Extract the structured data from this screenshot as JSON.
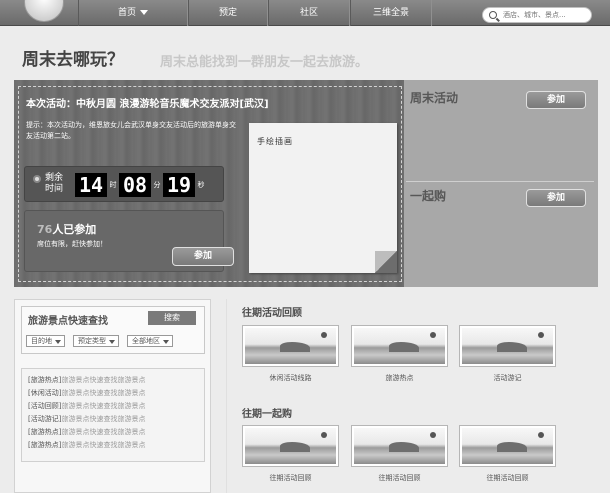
{
  "nav": {
    "items": [
      {
        "label": "首页",
        "dropdown": true
      },
      {
        "label": "预定",
        "dropdown": false
      },
      {
        "label": "社区",
        "dropdown": false
      },
      {
        "label": "三维全景",
        "dropdown": false
      }
    ],
    "search_placeholder": "酒店、城市、景点..."
  },
  "headline": {
    "title": "周末去哪玩？",
    "subtitle": "周末总能找到一群朋友一起去旅游。"
  },
  "event": {
    "title": "本次活动：中秋月圆 浪漫游轮音乐魔术交友派对[武汉]",
    "tip": "提示：本次活动为，维恩旅女儿会武汉单身交友活动后的旅游单身交友活动第二站。",
    "remain_label": "剩余时间",
    "hours": "14",
    "hours_unit": "时",
    "minutes": "08",
    "minutes_unit": "分",
    "seconds": "19",
    "seconds_unit": "秒",
    "join_num": "76",
    "join_suffix": "人已参加",
    "join_note": "席位有限，赶快参加！",
    "join_btn": "参加",
    "note_text": "手绘插画"
  },
  "side": {
    "weekend_title": "周末活动",
    "weekend_btn": "参加",
    "group_title": "一起购",
    "group_btn": "参加"
  },
  "quick_search": {
    "title": "旅游景点快速查找",
    "button": "搜索",
    "selects": [
      "目的地",
      "预定类型",
      "全部地区"
    ]
  },
  "list": [
    {
      "tag": "[旅游热点]",
      "text": "旅游景点快速查找旅游景点"
    },
    {
      "tag": "[休闲活动]",
      "text": "旅游景点快速查找旅游景点"
    },
    {
      "tag": "[活动回顾]",
      "text": "旅游景点快速查找旅游景点"
    },
    {
      "tag": "[活动游记]",
      "text": "旅游景点快速查找旅游景点"
    },
    {
      "tag": "[旅游热点]",
      "text": "旅游景点快速查找旅游景点"
    },
    {
      "tag": "[旅游热点]",
      "text": "旅游景点快速查找旅游景点"
    }
  ],
  "past": {
    "title": "往期活动回顾",
    "items": [
      "休闲活动线路",
      "旅游热点",
      "活动游记"
    ]
  },
  "group": {
    "title": "往期一起购",
    "items": [
      "往期活动回顾",
      "往期活动回顾",
      "往期活动回顾"
    ]
  },
  "colors": {
    "accent": "#7a7a7a",
    "nav_bg": "#6a6a6a",
    "feature_bg": "#a8a8a8"
  }
}
